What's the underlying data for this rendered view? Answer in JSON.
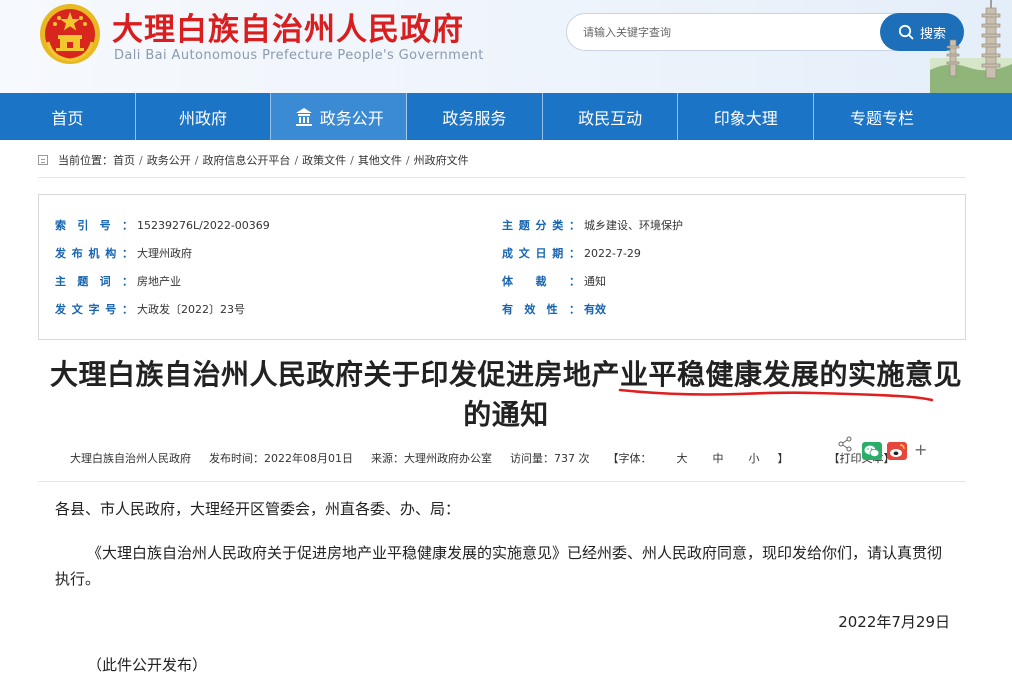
{
  "header": {
    "title": "大理白族自治州人民政府",
    "subtitle": "Dali Bai Autonomous Prefecture People's Government",
    "search_placeholder": "请输入关键字查询",
    "search_button": "搜索"
  },
  "nav": {
    "items": [
      {
        "label": "首页"
      },
      {
        "label": "州政府"
      },
      {
        "label": "政务公开"
      },
      {
        "label": "政务服务"
      },
      {
        "label": "政民互动"
      },
      {
        "label": "印象大理"
      },
      {
        "label": "专题专栏"
      }
    ]
  },
  "breadcrumb": {
    "prefix": "当前位置：",
    "items": [
      "首页",
      "政务公开",
      "政府信息公开平台",
      "政策文件",
      "其他文件",
      "州政府文件"
    ]
  },
  "info": {
    "index_label": "索引号：",
    "index_value": "15239276L/2022-00369",
    "category_label": "主题分类：",
    "category_value": "城乡建设、环境保护",
    "publisher_label": "发布机构：",
    "publisher_value": "大理州政府",
    "date_label": "成文日期：",
    "date_value": "2022-7-29",
    "topic_label": "主题词：",
    "topic_value": "房地产业",
    "genre_label": "体裁：",
    "genre_value": "通知",
    "docno_label": "发文字号：",
    "docno_value": "大政发〔2022〕23号",
    "validity_label": "有效性：",
    "validity_value": "有效"
  },
  "article": {
    "title_line1": "大理白族自治州人民政府关于印发促进房地产业平稳健康发展的实施意见",
    "title_line2": "的通知",
    "meta_publisher": "大理白族自治州人民政府",
    "meta_time": "发布时间：2022年08月01日",
    "meta_source": "来源：大理州政府办公室",
    "meta_views": "访问量：737 次",
    "font_prefix": "【字体：",
    "font_large": "大",
    "font_medium": "中",
    "font_small": "小",
    "font_suffix": "】",
    "print": "【打印文本】",
    "share_plus": "+",
    "para1": "各县、市人民政府，大理经开区管委会，州直各委、办、局：",
    "para2": "《大理白族自治州人民政府关于促进房地产业平稳健康发展的实施意见》已经州委、州人民政府同意，现印发给你们，请认真贯彻执行。",
    "date": "2022年7月29日",
    "note": "（此件公开发布）"
  },
  "colors": {
    "nav_blue": "#1b74c5",
    "nav_active": "#3a8ad4",
    "title_red": "#d81e1e",
    "label_blue": "#1764b0",
    "annotation_red": "#e02020"
  }
}
